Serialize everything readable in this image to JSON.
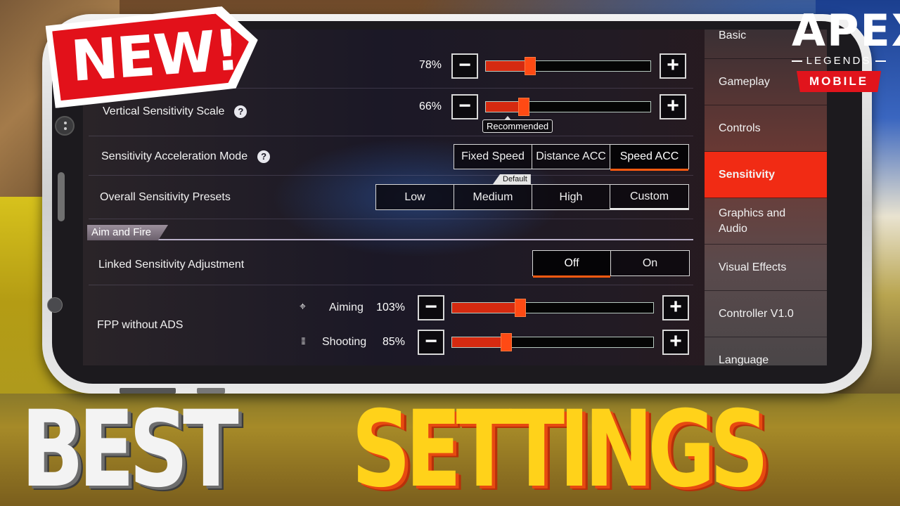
{
  "thumbnail": {
    "badge": "NEW!",
    "headline_left": "BEST",
    "headline_right": "SETTINGS",
    "logo": {
      "title": "APEX",
      "subtitle": "LEGENDS",
      "platform": "MOBILE"
    }
  },
  "settings": {
    "horizontal_scale": {
      "value_label": "78%",
      "value": 78,
      "fill_fraction": 0.27
    },
    "vertical_scale": {
      "label": "Vertical Sensitivity Scale",
      "value_label": "66%",
      "value": 66,
      "fill_fraction": 0.23,
      "tooltip": "Recommended"
    },
    "acceleration_mode": {
      "label": "Sensitivity Acceleration Mode",
      "options": [
        "Fixed Speed",
        "Distance ACC",
        "Speed ACC"
      ],
      "selected": "Speed ACC"
    },
    "presets": {
      "label": "Overall Sensitivity Presets",
      "default_tag": "Default",
      "options": [
        "Low",
        "Medium",
        "High",
        "Custom"
      ],
      "selected": "Custom"
    },
    "section_aim_fire": "Aim and Fire",
    "linked_adjustment": {
      "label": "Linked Sensitivity Adjustment",
      "options": [
        "Off",
        "On"
      ],
      "selected": "Off"
    },
    "fpp_without_ads": {
      "label": "FPP without ADS",
      "aiming": {
        "label": "Aiming",
        "value_label": "103%",
        "value": 103,
        "fill_fraction": 0.34
      },
      "shooting": {
        "label": "Shooting",
        "value_label": "85%",
        "value": 85,
        "fill_fraction": 0.27
      }
    },
    "minus": "−",
    "plus": "+",
    "help": "?"
  },
  "sidebar": {
    "items": [
      {
        "label": "Basic"
      },
      {
        "label": "Gameplay"
      },
      {
        "label": "Controls"
      },
      {
        "label": "Sensitivity",
        "active": true
      },
      {
        "label": "Graphics and Audio"
      },
      {
        "label": "Visual Effects"
      },
      {
        "label": "Controller V1.0"
      },
      {
        "label": "Language"
      }
    ]
  },
  "icons": {
    "crosshair": "⌖",
    "bullets": "⁞⁞⁞"
  }
}
